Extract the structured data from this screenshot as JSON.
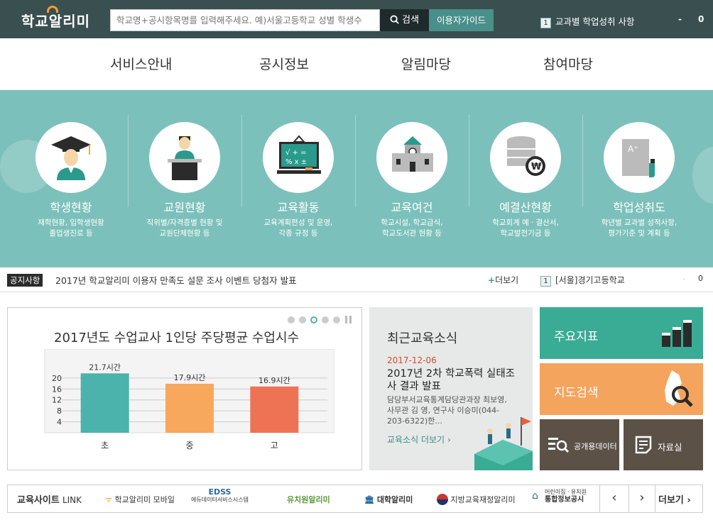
{
  "header": {
    "logo": "학교알리미",
    "search_placeholder": "학교명+공시항목명를 입력해주세요. 예)서울고등학교 성별 학생수",
    "search_button": "검색",
    "guide_button": "이용자가이드",
    "rank_number": "1",
    "rank_text": "교과별 학업성취 사항",
    "rank_dash": "-",
    "rank_count": "0"
  },
  "nav": [
    "서비스안내",
    "공시정보",
    "알림마당",
    "참여마당"
  ],
  "categories": [
    {
      "title": "학생현황",
      "desc1": "재학현황, 입학생현황",
      "desc2": "졸업생진로 등"
    },
    {
      "title": "교원현황",
      "desc1": "직위별/자격증별 현황 및",
      "desc2": "교원단체현황 등"
    },
    {
      "title": "교육활동",
      "desc1": "교육계획편성 및 운영,",
      "desc2": "각종 규정 등"
    },
    {
      "title": "교육여건",
      "desc1": "학교시설, 학교급식,",
      "desc2": "학교도서관 현황 등"
    },
    {
      "title": "예결산현황",
      "desc1": "학교회계 예ㆍ결산서,",
      "desc2": "학교발전기금 등"
    },
    {
      "title": "학업성취도",
      "desc1": "학년별 교과별 성적사항,",
      "desc2": "평가기준 및 계획 등"
    }
  ],
  "notice": {
    "label": "공지사항",
    "text": "2017년 학교알리미 이용자 만족도 설문 조사 이벤트 당첨자 발표",
    "more": "더보기",
    "rank_number": "1",
    "rank_text": "[서울]경기고등학교",
    "rank_dash": "-",
    "rank_count": "0"
  },
  "chart_data": {
    "type": "bar",
    "title": "2017년도 수업교사 1인당 주당평균 수업시수",
    "categories": [
      "초",
      "중",
      "고"
    ],
    "values": [
      21.7,
      17.9,
      16.9
    ],
    "value_labels": [
      "21.7시간",
      "17.9시간",
      "16.9시간"
    ],
    "yticks": [
      "20",
      "16",
      "12",
      "8",
      "4"
    ],
    "ylim": [
      0,
      28
    ],
    "colors": [
      "#4bb3ac",
      "#f7a85c",
      "#ee7355"
    ],
    "grid": true
  },
  "news": {
    "title": "최근교육소식",
    "date": "2017-12-06",
    "headline": "2017년 2차 학교폭력 실태조사 결과 발표",
    "body": "담당부서교육통계담당관과장 최보영, 사무관 김 영, 연구사 이승미(044-203-6322)한...",
    "more": "교육소식 더보기"
  },
  "tiles": {
    "indicators": "주요지표",
    "map_search": "지도검색",
    "open_data": "공개용데이터",
    "resources": "자료실"
  },
  "sites": {
    "label_bold": "교육사이트",
    "label_link": "LINK",
    "items": [
      "학교알리미 모바일",
      "EDSS",
      "에듀데이터서비스시스템",
      "유치원알리미",
      "대학알리미",
      "지방교육재정알리미",
      "어린이집ㆍ유치원",
      "통합정보공시"
    ],
    "prev": "‹",
    "next": "›",
    "more": "더보기"
  }
}
